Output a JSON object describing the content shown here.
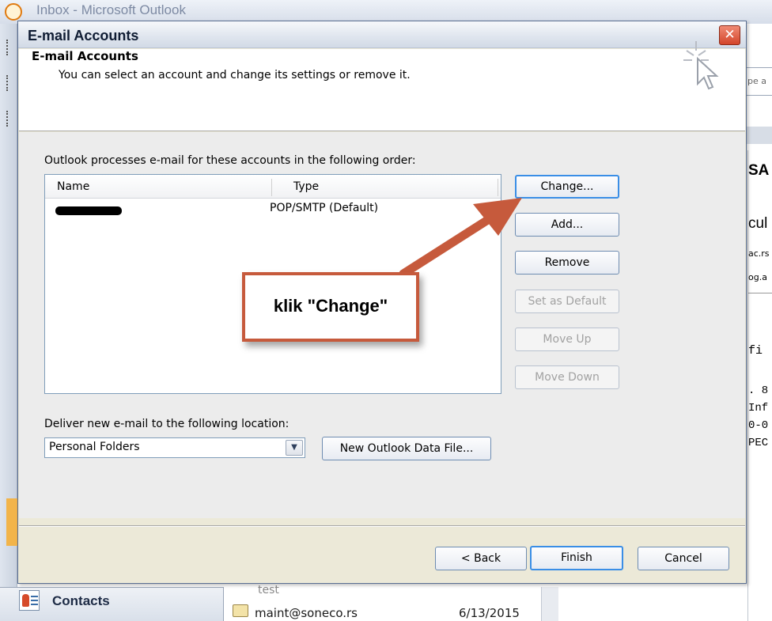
{
  "background": {
    "window_title": "Inbox - Microsoft Outlook",
    "search_fragment": "pe a",
    "reading_fragments": [
      "SA",
      "cul",
      "ac.rs",
      "og.a",
      "fi",
      ". 8",
      "Inf",
      "0-0",
      "PEC"
    ],
    "contacts_label": "Contacts",
    "list_test": "test",
    "list_from": "maint@soneco.rs",
    "list_date": "6/13/2015"
  },
  "dialog": {
    "title": "E-mail Accounts",
    "close_glyph": "✕",
    "header": {
      "title": "E-mail Accounts",
      "subtitle": "You can select an account and change its settings or remove it."
    },
    "list_caption": "Outlook processes e-mail for these accounts in the following order:",
    "columns": {
      "name": "Name",
      "type": "Type"
    },
    "accounts": [
      {
        "name": "",
        "type": "POP/SMTP (Default)"
      }
    ],
    "side_buttons": {
      "change": "Change...",
      "add": "Add...",
      "remove": "Remove",
      "set_default": "Set as Default",
      "move_up": "Move Up",
      "move_down": "Move Down"
    },
    "deliver_caption": "Deliver new e-mail to the following location:",
    "deliver_value": "Personal Folders",
    "new_data_file": "New Outlook Data File...",
    "footer": {
      "back": "< Back",
      "finish": "Finish",
      "cancel": "Cancel"
    }
  },
  "annotation": {
    "text": "klik \"Change\"",
    "color": "#c65a3c"
  },
  "icons": [
    "wizard-cursor-icon",
    "close-icon",
    "dropdown-arrow-icon",
    "contacts-icon",
    "mail-icon"
  ]
}
